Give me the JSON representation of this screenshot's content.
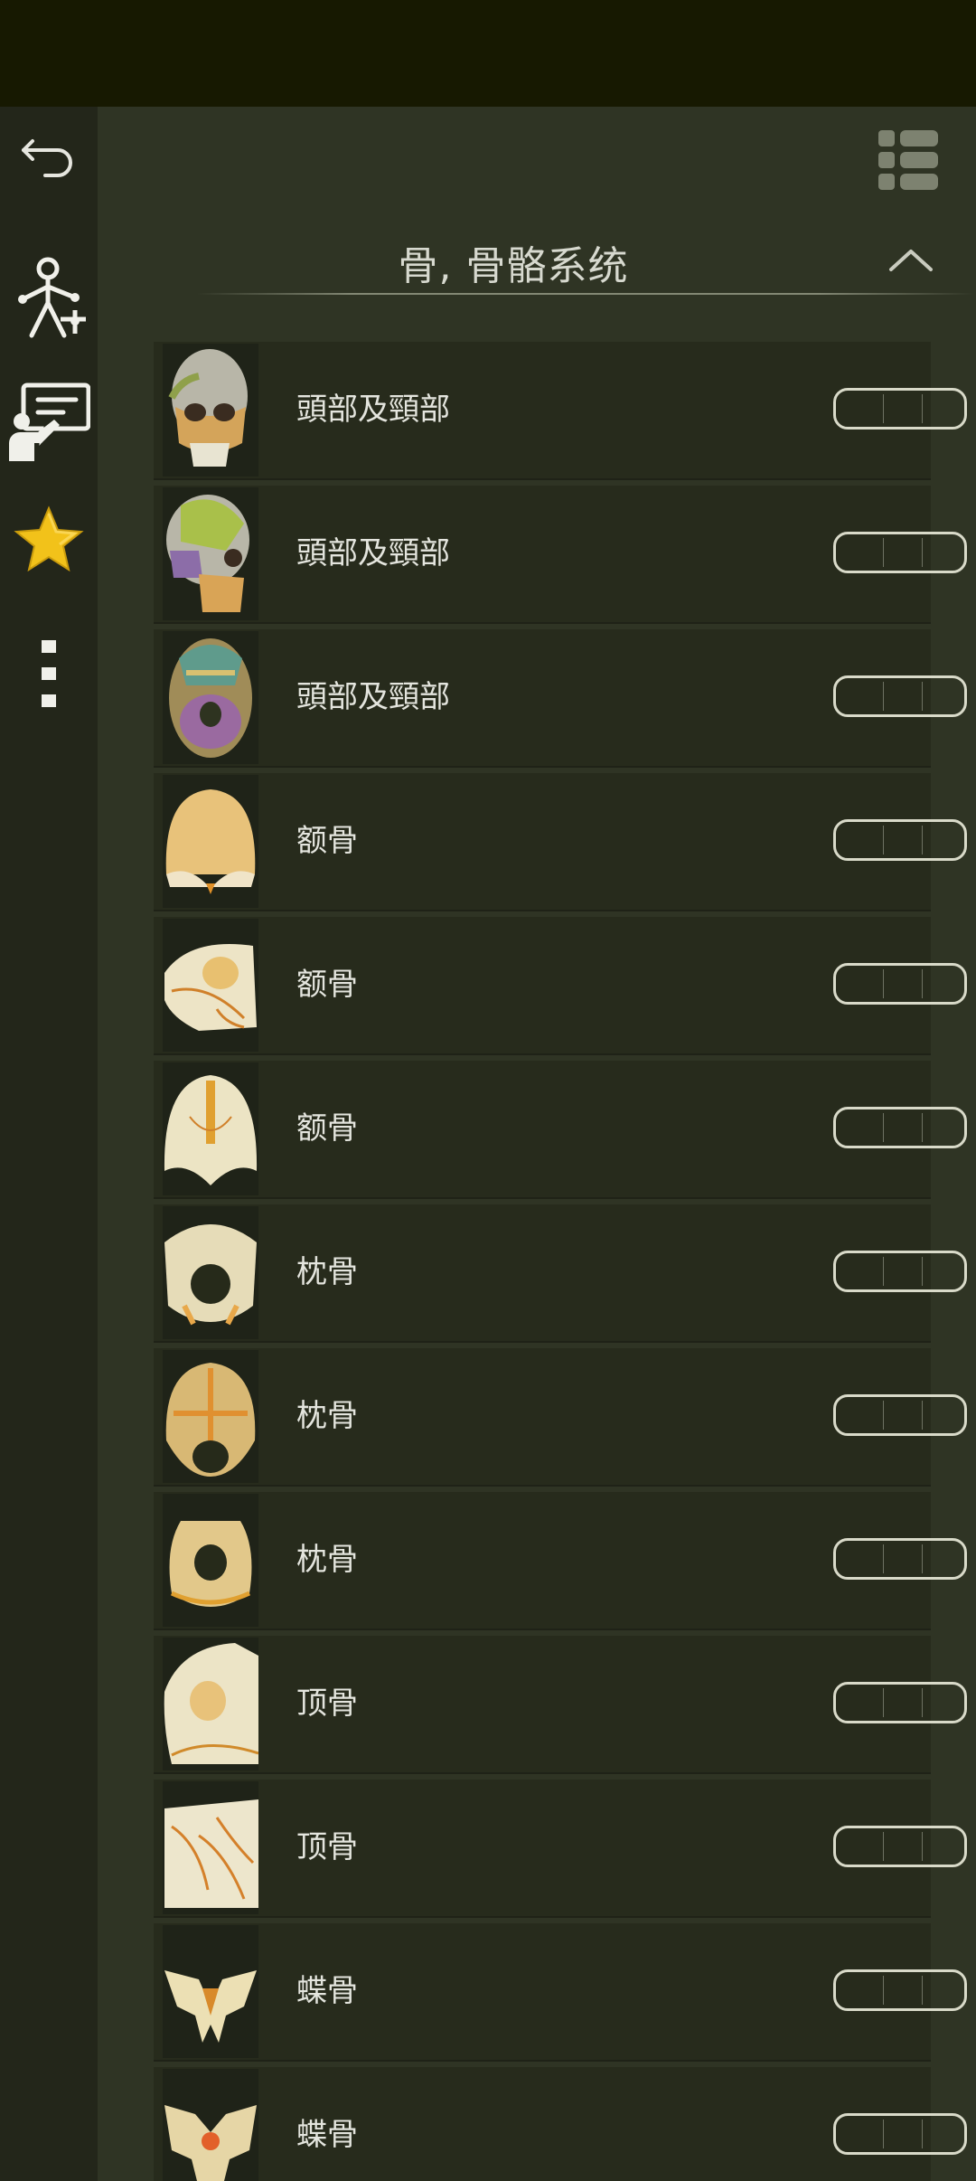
{
  "header": {
    "section_title": "骨, 骨骼系统"
  },
  "sidebar": {
    "items": [
      {
        "name": "back-icon"
      },
      {
        "name": "anatomy-model-icon"
      },
      {
        "name": "quiz-presenter-icon"
      },
      {
        "name": "star-icon"
      },
      {
        "name": "more-vertical-icon"
      }
    ]
  },
  "colors": {
    "status_bar": "#171901",
    "sidebar": "#23261a",
    "main_bg": "#2f3424",
    "row_bg": "#272b1c",
    "text": "#e4e5de",
    "star": "#f2c21a"
  },
  "rows": [
    {
      "label": "頭部及頸部",
      "thumb": "skull-front-colored"
    },
    {
      "label": "頭部及頸部",
      "thumb": "skull-lateral-colored"
    },
    {
      "label": "頭部及頸部",
      "thumb": "skull-inferior-colored"
    },
    {
      "label": "额骨",
      "thumb": "frontal-bone-anterior"
    },
    {
      "label": "额骨",
      "thumb": "frontal-bone-lateral"
    },
    {
      "label": "额骨",
      "thumb": "frontal-bone-posterior"
    },
    {
      "label": "枕骨",
      "thumb": "occipital-bone-inferior"
    },
    {
      "label": "枕骨",
      "thumb": "occipital-bone-anterior"
    },
    {
      "label": "枕骨",
      "thumb": "occipital-bone-superior"
    },
    {
      "label": "顶骨",
      "thumb": "parietal-bone-external"
    },
    {
      "label": "顶骨",
      "thumb": "parietal-bone-internal"
    },
    {
      "label": "蝶骨",
      "thumb": "sphenoid-bone-anterior"
    },
    {
      "label": "蝶骨",
      "thumb": "sphenoid-bone-posterior"
    }
  ]
}
